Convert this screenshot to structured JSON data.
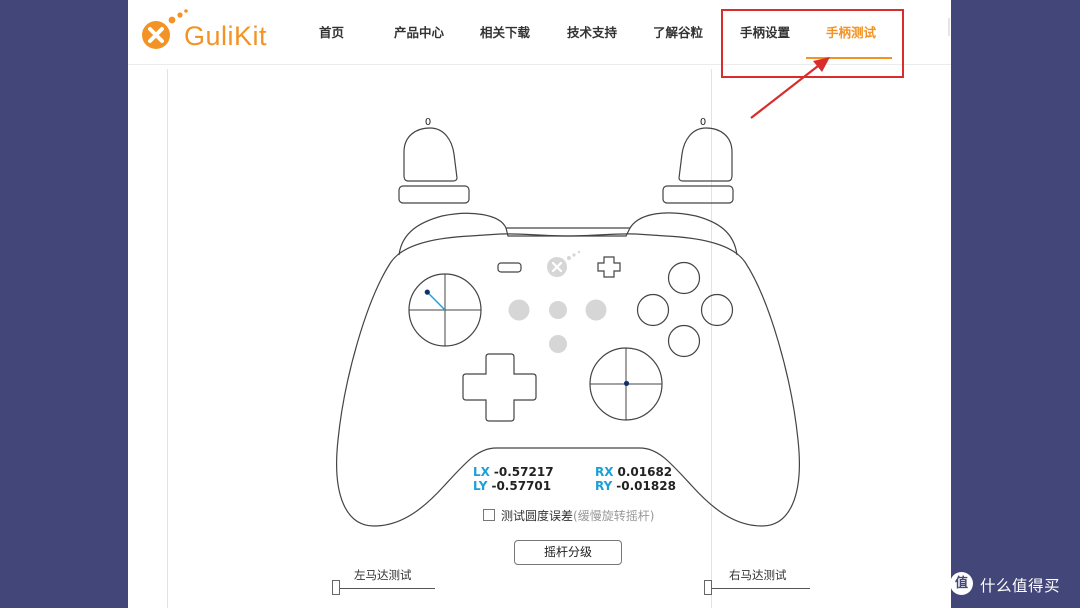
{
  "brand": {
    "name": "GuliKit",
    "color": "#f39325"
  },
  "nav": {
    "items": [
      {
        "label": "首页"
      },
      {
        "label": "产品中心"
      },
      {
        "label": "相关下载"
      },
      {
        "label": "技术支持"
      },
      {
        "label": "了解谷粒"
      },
      {
        "label": "手柄设置"
      },
      {
        "label": "手柄测试",
        "active": true
      }
    ]
  },
  "triggers": {
    "left_value": "0",
    "right_value": "0"
  },
  "axes": {
    "lx_label": "LX",
    "lx_value": "-0.57217",
    "ly_label": "LY",
    "ly_value": "-0.57701",
    "rx_label": "RX",
    "rx_value": "0.01682",
    "ry_label": "RY",
    "ry_value": "-0.01828"
  },
  "stick_positions": {
    "left": {
      "x": -0.57217,
      "y": -0.57701
    },
    "right": {
      "x": 0.01682,
      "y": -0.01828
    }
  },
  "circularity_test": {
    "label": "测试圆度误差",
    "hint": "(缓慢旋转摇杆)",
    "checked": false
  },
  "grade_button": {
    "label": "摇杆分级"
  },
  "motors": {
    "left_label": "左马达测试",
    "right_label": "右马达测试",
    "left_level": 0,
    "right_level": 0
  },
  "annotation": {
    "color": "#d92c2c"
  },
  "watermark": {
    "icon_text": "值",
    "text": "什么值得买"
  }
}
